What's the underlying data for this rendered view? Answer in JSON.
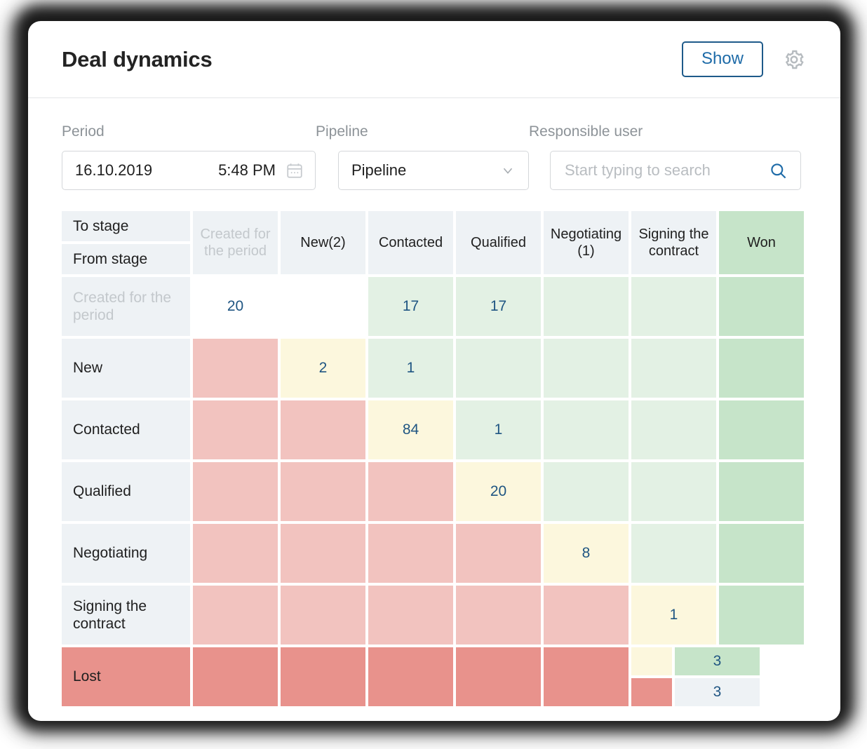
{
  "header": {
    "title": "Deal dynamics",
    "show_label": "Show",
    "gear_icon": "gear-icon"
  },
  "filters": {
    "period": {
      "label": "Period",
      "date_value": "16.10.2019",
      "time_value": "5:48 PM",
      "icon": "calendar-icon"
    },
    "pipeline": {
      "label": "Pipeline",
      "selected": "Pipeline",
      "icon": "chevron-down-icon"
    },
    "responsible_user": {
      "label": "Responsible user",
      "placeholder": "Start typing to search",
      "icon": "search-icon"
    }
  },
  "matrix": {
    "corner_to": "To stage",
    "corner_from": "From stage",
    "columns": [
      "Created for the period",
      "New(2)",
      "Contacted",
      "Qualified",
      "Negotiating (1)",
      "Signing the contract",
      "Won"
    ],
    "rows": [
      {
        "label": "Created for the period",
        "cells": [
          "20",
          "",
          "17",
          "17",
          "",
          "",
          ""
        ]
      },
      {
        "label": "New",
        "cells": [
          "",
          "2",
          "1",
          "",
          "",
          "",
          ""
        ]
      },
      {
        "label": "Contacted",
        "cells": [
          "",
          "",
          "84",
          "1",
          "",
          "",
          ""
        ]
      },
      {
        "label": "Qualified",
        "cells": [
          "",
          "",
          "",
          "20",
          "",
          "",
          ""
        ]
      },
      {
        "label": "Negotiating",
        "cells": [
          "",
          "",
          "",
          "",
          "8",
          "",
          ""
        ]
      },
      {
        "label": "Signing the contract",
        "cells": [
          "",
          "",
          "",
          "",
          "",
          "1",
          ""
        ]
      },
      {
        "label": "Lost",
        "cells": [
          "",
          "",
          "",
          "",
          "",
          "",
          ""
        ],
        "split": {
          "won_top": "3",
          "won_bottom": "3"
        }
      }
    ]
  },
  "colors": {
    "accent_blue": "#1e6ba8",
    "value_blue": "#1f5582",
    "header_grey": "#eef2f5",
    "cell_red": "#f2c3bf",
    "cell_red_dark": "#e8928c",
    "cell_cream": "#fcf7dd",
    "cell_green": "#e3f1e4",
    "cell_green_dark": "#c6e4c9"
  }
}
